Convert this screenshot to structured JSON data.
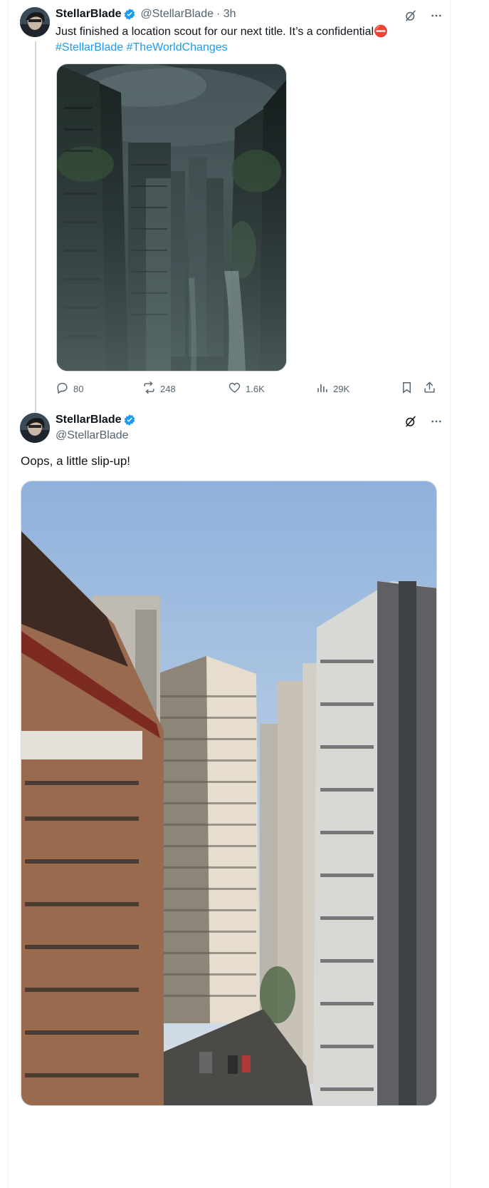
{
  "tweet1": {
    "display_name": "StellarBlade",
    "handle": "@StellarBlade",
    "time": "· 3h",
    "text": "Just finished a location scout for our next title. It’s a confidential",
    "emoji": "⛔",
    "hashtags": [
      "#StellarBlade",
      "#TheWorldChanges"
    ],
    "stats": {
      "replies": "80",
      "reposts": "248",
      "likes": "1.6K",
      "views": "29K"
    }
  },
  "tweet2": {
    "display_name": "StellarBlade",
    "handle": "@StellarBlade",
    "text": "Oops, a little slip-up!"
  },
  "colors": {
    "accent": "#1d9bf0",
    "muted": "#536471",
    "text": "#0f1419"
  },
  "icons": [
    "grok-icon",
    "more-icon",
    "reply-icon",
    "repost-icon",
    "like-icon",
    "views-icon",
    "bookmark-icon",
    "share-icon",
    "verified-badge-icon"
  ]
}
